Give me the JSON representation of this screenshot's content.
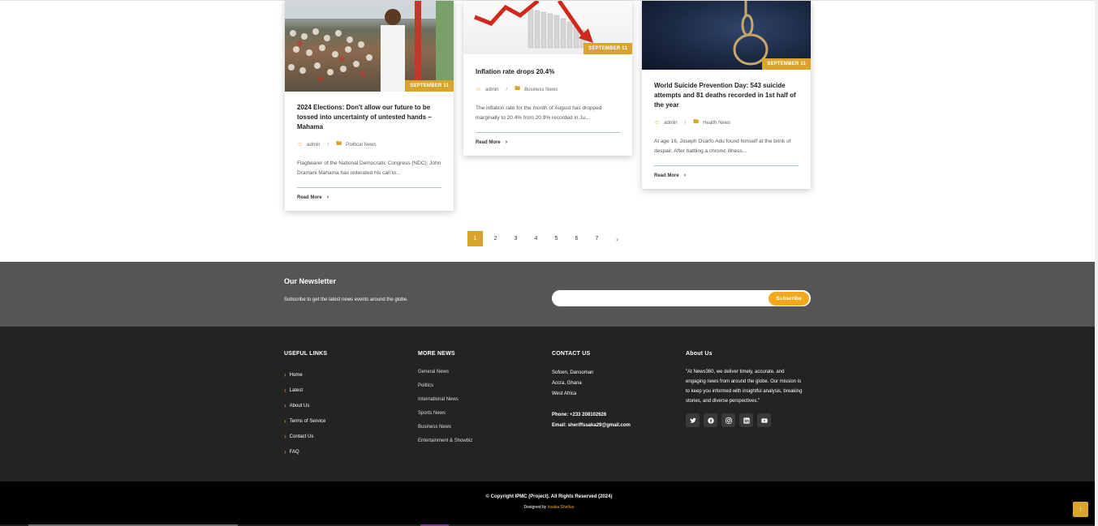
{
  "cards": [
    {
      "date": "SEPTEMBER 11",
      "title": "2024 Elections: Don't allow our future to be tossed into uncertainty of untested hands – Mahama",
      "author": "admin",
      "category": "Political News",
      "excerpt": "Flagbearer of the National Democratic Congress (NDC), John Dramani Mahama has reiterated his call to...",
      "read_more": "Read More",
      "image_icon": "crowd-photo"
    },
    {
      "date": "SEPTEMBER 11",
      "title": "Inflation rate drops 20.4%",
      "author": "admin",
      "category": "Business News",
      "excerpt": "The inflation rate for the month of August has dropped marginally to 20.4% from 20.9% recorded in Ju...",
      "read_more": "Read More",
      "image_icon": "chart-photo"
    },
    {
      "date": "SEPTEMBER 11",
      "title": "World Suicide Prevention Day: 543 suicide attempts and 81 deaths recorded in 1st half of the year",
      "author": "admin",
      "category": "Health News",
      "excerpt": "At age 16, Joseph Osarfo Adu found himself at the brink of despair. After battling a chronic illness...",
      "read_more": "Read More",
      "image_icon": "rope-photo"
    }
  ],
  "pagination": {
    "pages": [
      "1",
      "2",
      "3",
      "4",
      "5",
      "6",
      "7"
    ],
    "active": "1",
    "next_icon": "chevron-right-icon"
  },
  "newsletter": {
    "title": "Our Newsletter",
    "subtitle": "Subscribe to get the latest news events around the globe.",
    "input_value": "",
    "button": "Subscribe"
  },
  "footer": {
    "useful_links": {
      "title": "USEFUL LINKS",
      "items": [
        "Home",
        "Latest",
        "About Us",
        "Terms of Service",
        "Contact Us",
        "FAQ"
      ]
    },
    "more_news": {
      "title": "MORE NEWS",
      "items": [
        "General News",
        "Politics",
        "International News",
        "Sports News",
        "Business News",
        "Entertainment & Showbiz"
      ]
    },
    "contact": {
      "title": "CONTACT US",
      "address": [
        "Sofoen, Dansoman",
        "Accra, Ghana",
        "West Africa"
      ],
      "phone": "Phone: +233 208102626",
      "email": "Email: sheriffssaka29@gmail.com"
    },
    "about": {
      "title": "About Us",
      "text": "\"At News360, we deliver timely, accurate, and engaging news from around the globe. Our mission is to keep you informed with insightful analysis, breaking stories, and diverse perspectives.\"",
      "socials": [
        "twitter-icon",
        "facebook-icon",
        "instagram-icon",
        "linkedin-icon",
        "youtube-icon"
      ]
    }
  },
  "bottom": {
    "copyright": "© Copyright IPMC (Project). All Rights Reserved (2024)",
    "designed_prefix": "Designed by",
    "designer": "Issaka Sheifuu"
  },
  "colors": {
    "accent": "#d9a42b",
    "subscribe": "#f2a81d",
    "newsletter_bg": "#555555",
    "footer_bg": "#232323"
  }
}
